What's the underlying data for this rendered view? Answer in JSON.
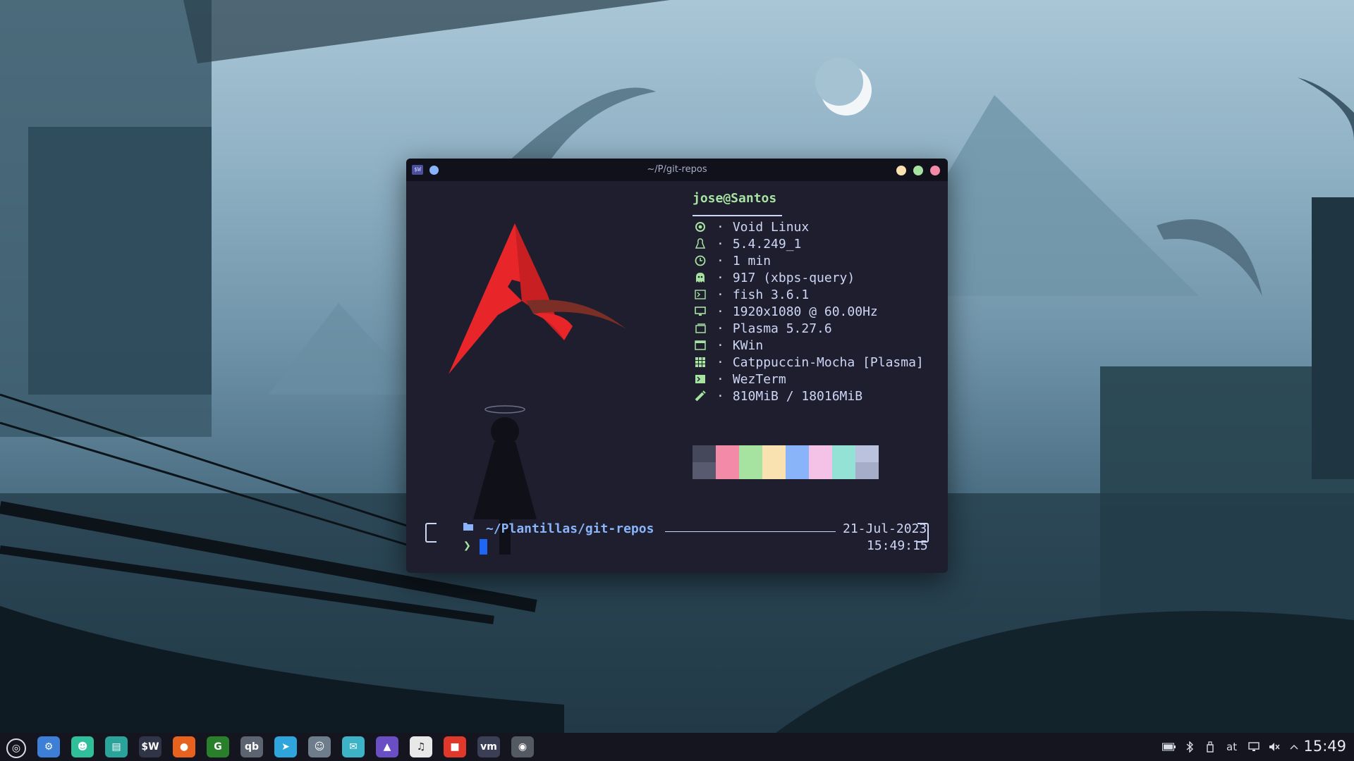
{
  "terminal": {
    "title": "~/P/git-repos",
    "logo_text": "$W",
    "user_host": "jose@Santos",
    "info": [
      {
        "icon": "void-icon",
        "value": "Void Linux"
      },
      {
        "icon": "tux-icon",
        "value": "5.4.249_1"
      },
      {
        "icon": "clock-icon",
        "value": "1 min"
      },
      {
        "icon": "ghost-icon",
        "value": "917 (xbps-query)"
      },
      {
        "icon": "shell-icon",
        "value": "fish 3.6.1"
      },
      {
        "icon": "monitor-icon",
        "value": "1920x1080 @ 60.00Hz"
      },
      {
        "icon": "desktop-icon",
        "value": "Plasma 5.27.6"
      },
      {
        "icon": "window-icon",
        "value": "KWin"
      },
      {
        "icon": "grid-icon",
        "value": "Catppuccin-Mocha [Plasma]"
      },
      {
        "icon": "terminal-icon",
        "value": "WezTerm"
      },
      {
        "icon": "memory-icon",
        "value": "810MiB / 18016MiB"
      }
    ],
    "separator": "·",
    "palette": [
      {
        "top": "#45475a",
        "bottom": "#585b70"
      },
      {
        "top": "#f38ba8",
        "bottom": "#f38ba8"
      },
      {
        "top": "#a6e3a1",
        "bottom": "#a6e3a1"
      },
      {
        "top": "#f9e2af",
        "bottom": "#f9e2af"
      },
      {
        "top": "#89b4fa",
        "bottom": "#89b4fa"
      },
      {
        "top": "#f5c2e7",
        "bottom": "#f5c2e7"
      },
      {
        "top": "#94e2d5",
        "bottom": "#94e2d5"
      },
      {
        "top": "#bac2de",
        "bottom": "#a6adc8"
      }
    ],
    "prompt": {
      "cwd": "~/Plantillas/git-repos",
      "date": "21-Jul-2023",
      "time": "15:49:15",
      "chevron": "❯"
    }
  },
  "taskbar": {
    "apps": [
      {
        "name": "launcher",
        "label": "◎",
        "bg": "#151520"
      },
      {
        "name": "settings",
        "label": "⚙",
        "bg": "#3d7fd6"
      },
      {
        "name": "ghost-app",
        "label": "☻",
        "bg": "#2fbf9b"
      },
      {
        "name": "files",
        "label": "▤",
        "bg": "#2aa39a"
      },
      {
        "name": "wezterm",
        "label": "$W",
        "bg": "#2f3446"
      },
      {
        "name": "firefox",
        "label": "●",
        "bg": "#e7621f"
      },
      {
        "name": "gimp-like",
        "label": "G",
        "bg": "#2a7f2a"
      },
      {
        "name": "qbittorrent",
        "label": "qb",
        "bg": "#5b6470"
      },
      {
        "name": "telegram",
        "label": "➤",
        "bg": "#2ea6db"
      },
      {
        "name": "avatar-app",
        "label": "☺",
        "bg": "#6d7d8c"
      },
      {
        "name": "chat",
        "label": "✉",
        "bg": "#3db3c7"
      },
      {
        "name": "geometry",
        "label": "▲",
        "bg": "#6a4fc4"
      },
      {
        "name": "audio",
        "label": "♫",
        "bg": "#e8e8e8"
      },
      {
        "name": "recorder",
        "label": "■",
        "bg": "#e0392b"
      },
      {
        "name": "vm",
        "label": "vm",
        "bg": "#3b3f55"
      },
      {
        "name": "camera",
        "label": "◉",
        "bg": "#545a64"
      }
    ],
    "tray": {
      "keyboard_layout": "at"
    },
    "clock": "15:49"
  }
}
